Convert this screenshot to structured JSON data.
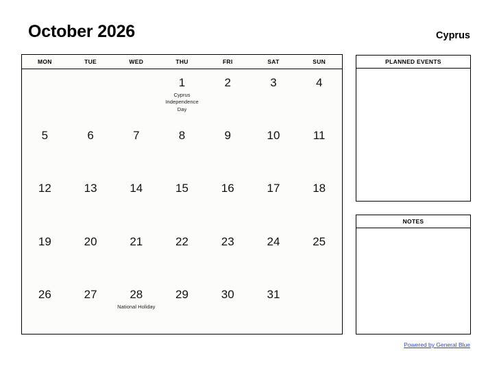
{
  "header": {
    "month_title": "October 2026",
    "country": "Cyprus"
  },
  "calendar": {
    "day_headers": [
      "MON",
      "TUE",
      "WED",
      "THU",
      "FRI",
      "SAT",
      "SUN"
    ],
    "weeks": [
      [
        {
          "day": "",
          "event": ""
        },
        {
          "day": "",
          "event": ""
        },
        {
          "day": "",
          "event": ""
        },
        {
          "day": "1",
          "event": "Cyprus Independence Day"
        },
        {
          "day": "2",
          "event": ""
        },
        {
          "day": "3",
          "event": ""
        },
        {
          "day": "4",
          "event": ""
        }
      ],
      [
        {
          "day": "5",
          "event": ""
        },
        {
          "day": "6",
          "event": ""
        },
        {
          "day": "7",
          "event": ""
        },
        {
          "day": "8",
          "event": ""
        },
        {
          "day": "9",
          "event": ""
        },
        {
          "day": "10",
          "event": ""
        },
        {
          "day": "11",
          "event": ""
        }
      ],
      [
        {
          "day": "12",
          "event": ""
        },
        {
          "day": "13",
          "event": ""
        },
        {
          "day": "14",
          "event": ""
        },
        {
          "day": "15",
          "event": ""
        },
        {
          "day": "16",
          "event": ""
        },
        {
          "day": "17",
          "event": ""
        },
        {
          "day": "18",
          "event": ""
        }
      ],
      [
        {
          "day": "19",
          "event": ""
        },
        {
          "day": "20",
          "event": ""
        },
        {
          "day": "21",
          "event": ""
        },
        {
          "day": "22",
          "event": ""
        },
        {
          "day": "23",
          "event": ""
        },
        {
          "day": "24",
          "event": ""
        },
        {
          "day": "25",
          "event": ""
        }
      ],
      [
        {
          "day": "26",
          "event": ""
        },
        {
          "day": "27",
          "event": ""
        },
        {
          "day": "28",
          "event": "National Holiday"
        },
        {
          "day": "29",
          "event": ""
        },
        {
          "day": "30",
          "event": ""
        },
        {
          "day": "31",
          "event": ""
        },
        {
          "day": "",
          "event": ""
        }
      ]
    ]
  },
  "panels": {
    "planned_events": {
      "title": "PLANNED EVENTS",
      "content": ""
    },
    "notes": {
      "title": "NOTES",
      "content": ""
    }
  },
  "footer": {
    "link_text": "Powered by General Blue",
    "link_color": "#2c4bbd"
  }
}
